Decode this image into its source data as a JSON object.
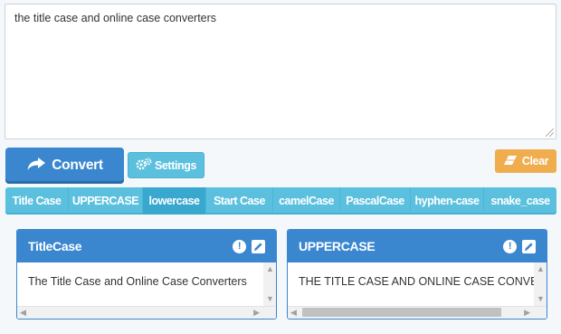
{
  "input": {
    "text": "the title case and online case converters"
  },
  "toolbar": {
    "convert_label": "Convert",
    "settings_label": "Settings",
    "clear_label": "Clear"
  },
  "tabs": [
    {
      "label": "Title Case",
      "active": false
    },
    {
      "label": "UPPERCASE",
      "active": false
    },
    {
      "label": "lowercase",
      "active": true
    },
    {
      "label": "Start Case",
      "active": false
    },
    {
      "label": "camelCase",
      "active": false
    },
    {
      "label": "PascalCase",
      "active": false
    },
    {
      "label": "hyphen-case",
      "active": false
    },
    {
      "label": "snake_case",
      "active": false
    }
  ],
  "panels": [
    {
      "title": "TitleCase",
      "output": "The Title Case and Online Case Converters"
    },
    {
      "title": "UPPERCASE",
      "output": "THE TITLE CASE AND ONLINE CASE CONVERTERS"
    }
  ],
  "colors": {
    "primary": "#3a87cf",
    "info": "#5bc0de",
    "warning": "#f0ad4e"
  },
  "icons": {
    "convert": "share-arrow-icon",
    "settings": "gears-icon",
    "clear": "eraser-icon",
    "panel_info": "exclamation-circle-icon",
    "panel_edit": "pencil-icon"
  }
}
